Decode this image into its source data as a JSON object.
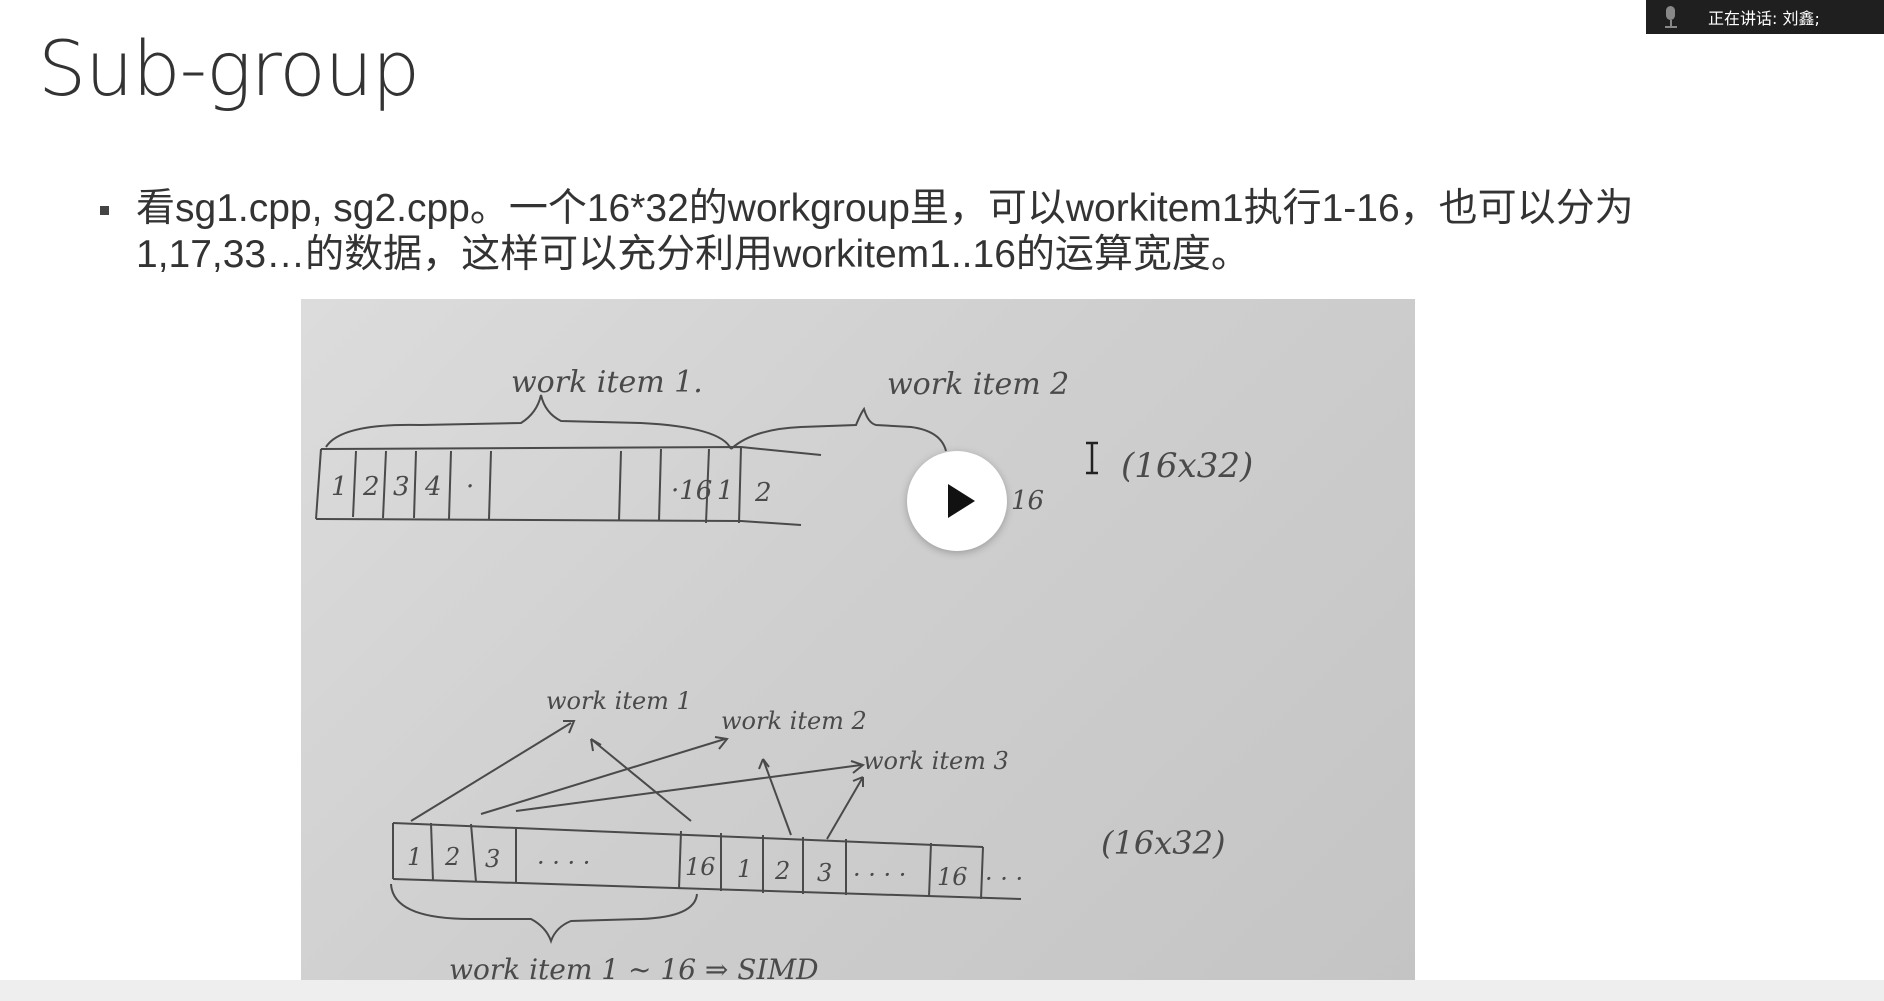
{
  "slide": {
    "title": "Sub-group",
    "bullet": "看sg1.cpp, sg2.cpp。一个16*32的workgroup里，可以workitem1执行1-16，也可以分为1,17,33…的数据，这样可以充分利用workitem1..16的运算宽度。"
  },
  "photo": {
    "top_label_1": "work item 1.",
    "top_label_2": "work item 2",
    "top_dims": "(16x32)",
    "bottom_label_1": "work item 1",
    "bottom_label_2": "work item 2",
    "bottom_label_3": "work item 3",
    "bottom_dims": "(16x32)",
    "bottom_caption": "work item 1 ~ 16   ⇒ SIMD",
    "cells_top": [
      "1",
      "2",
      "3",
      "4",
      "·",
      "",
      "",
      "",
      "·16",
      "1",
      "2"
    ],
    "cell_top_end": "16",
    "cells_bottom": [
      "1",
      "2",
      "3",
      "· · · ·",
      "16",
      "1",
      "2",
      "3",
      "· · · ·",
      "16",
      "· · ·"
    ]
  },
  "video": {
    "play_icon": "play-icon"
  },
  "meeting": {
    "speaking_label": "正在讲话: 刘鑫;"
  }
}
